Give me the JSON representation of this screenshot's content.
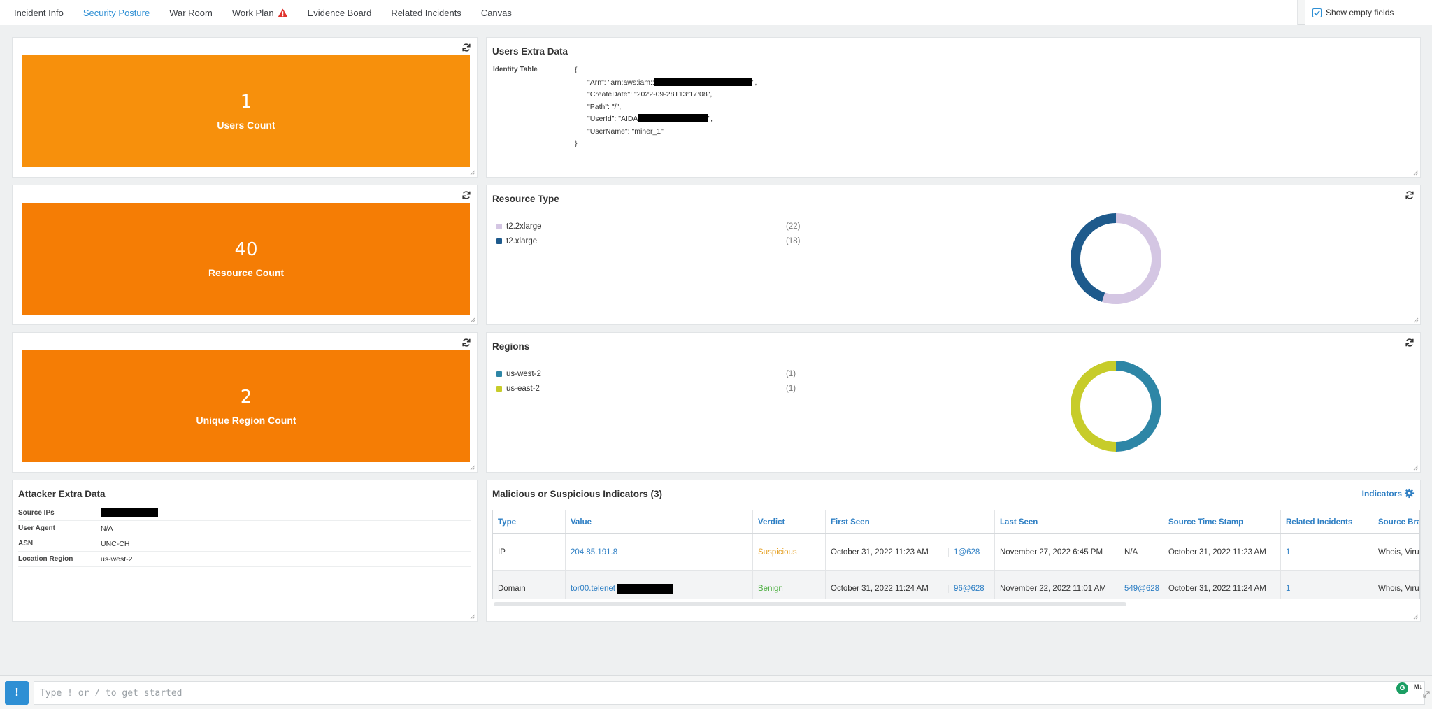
{
  "tabs": [
    {
      "label": "Incident Info",
      "active": false
    },
    {
      "label": "Security Posture",
      "active": true
    },
    {
      "label": "War Room",
      "active": false
    },
    {
      "label": "Work Plan",
      "active": false,
      "warning": true
    },
    {
      "label": "Evidence Board",
      "active": false
    },
    {
      "label": "Related Incidents",
      "active": false
    },
    {
      "label": "Canvas",
      "active": false
    }
  ],
  "show_empty_fields": {
    "label": "Show empty fields",
    "checked": true
  },
  "stats": [
    {
      "value": "1",
      "label": "Users Count",
      "color": "#f7900c"
    },
    {
      "value": "40",
      "label": "Resource Count",
      "color": "#f57d05"
    },
    {
      "value": "2",
      "label": "Unique Region Count",
      "color": "#f57d05"
    }
  ],
  "users_extra": {
    "title": "Users Extra Data",
    "key": "Identity Table",
    "json_open": "{",
    "json_close": "}",
    "lines": [
      {
        "pre": "\"Arn\": \"arn:aws:iam::",
        "post": "\","
      },
      {
        "pre": "\"CreateDate\": \"2022-09-28T13:17:08\",",
        "post": ""
      },
      {
        "pre": "\"Path\": \"/\",",
        "post": ""
      },
      {
        "pre": "\"UserId\": \"AIDA",
        "post": "\","
      },
      {
        "pre": "\"UserName\": \"miner_1\"",
        "post": ""
      }
    ]
  },
  "resource_type": {
    "title": "Resource Type",
    "items": [
      {
        "name": "t2.2xlarge",
        "count": "(22)",
        "value": 22,
        "color": "#d4c6e3"
      },
      {
        "name": "t2.xlarge",
        "count": "(18)",
        "value": 18,
        "color": "#1e5a8c"
      }
    ]
  },
  "regions": {
    "title": "Regions",
    "items": [
      {
        "name": "us-west-2",
        "count": "(1)",
        "value": 1,
        "color": "#2e86a6"
      },
      {
        "name": "us-east-2",
        "count": "(1)",
        "value": 1,
        "color": "#c7cc2a"
      }
    ]
  },
  "attacker": {
    "title": "Attacker Extra Data",
    "rows": [
      {
        "key": "Source IPs",
        "value": ""
      },
      {
        "key": "User Agent",
        "value": "N/A"
      },
      {
        "key": "ASN",
        "value": "UNC-CH"
      },
      {
        "key": "Location Region",
        "value": "us-west-2"
      }
    ]
  },
  "indicators": {
    "title": "Malicious or Suspicious Indicators (3)",
    "link_label": "Indicators",
    "headers": [
      "Type",
      "Value",
      "Verdict",
      "First Seen",
      "Last Seen",
      "Source Time Stamp",
      "Related Incidents",
      "Source Brands"
    ],
    "rows": [
      {
        "type": "IP",
        "value": "204.85.191.8",
        "verdict": "Suspicious",
        "first_seen": "October 31, 2022 11:23 AM",
        "first_seen_ref": "1@628",
        "last_seen": "November 27, 2022 6:45 PM",
        "last_seen_ref": "N/A",
        "source_ts": "October 31, 2022 11:23 AM",
        "related": "1",
        "brands": "Whois, VirusTotal"
      },
      {
        "type": "Domain",
        "value": "tor00.telenet",
        "verdict": "Benign",
        "first_seen": "October 31, 2022 11:24 AM",
        "first_seen_ref": "96@628",
        "last_seen": "November 22, 2022 11:01 AM",
        "last_seen_ref": "549@628",
        "source_ts": "October 31, 2022 11:24 AM",
        "related": "1",
        "brands": "Whois, VirusTotal"
      }
    ]
  },
  "command": {
    "button": "!",
    "placeholder": "Type ! or / to get started",
    "g_badge": "G",
    "md_badge": "M↓"
  }
}
